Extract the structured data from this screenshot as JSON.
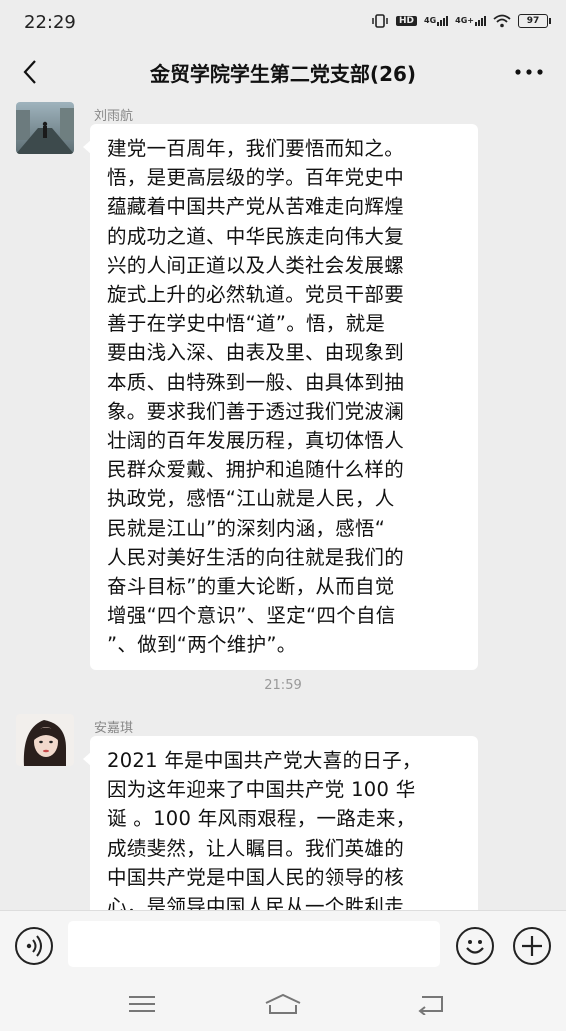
{
  "status_bar": {
    "time": "22:29",
    "hd_label": "HD",
    "net1": "4G",
    "net2": "4G+",
    "battery": "97"
  },
  "header": {
    "title": "金贸学院学生第二党支部(26)",
    "back_icon": "chevron-left-icon",
    "more_icon": "more-dots-icon"
  },
  "messages": [
    {
      "sender": "刘雨航",
      "lines": [
        "建党一百周年，我们要悟而知之。",
        "悟，是更高层级的学。百年党史中",
        "蕴藏着中国共产党从苦难走向辉煌",
        "的成功之道、中华民族走向伟大复",
        "兴的人间正道以及人类社会发展螺",
        "旋式上升的必然轨道。党员干部要",
        "善于在学史中悟“道”。悟，就是",
        "要由浅入深、由表及里、由现象到",
        "本质、由特殊到一般、由具体到抽",
        "象。要求我们善于透过我们党波澜",
        "壮阔的百年发展历程，真切体悟人",
        "民群众爱戴、拥护和追随什么样的",
        "执政党，感悟“江山就是人民，人",
        "民就是江山”的深刻内涵，感悟“",
        "人民对美好生活的向往就是我们的",
        "奋斗目标”的重大论断，从而自觉",
        "增强“四个意识”、坚定“四个自信",
        "”、做到“两个维护”。"
      ]
    },
    {
      "sender": "安嘉琪",
      "lines": [
        "2021 年是中国共产党大喜的日子，",
        "因为这年迎来了中国共产党 100 华",
        "诞 。100 年风雨艰程，一路走来，",
        "成绩斐然，让人瞩目。我们英雄的",
        "中国共产党是中国人民的领导的核",
        "心，是领导中国人民从一个胜利走"
      ]
    }
  ],
  "timestamp": "21:59",
  "input_bar": {
    "voice_icon": "voice-icon",
    "emoji_icon": "emoji-icon",
    "plus_icon": "plus-icon",
    "placeholder": ""
  },
  "nav_bar": {
    "menu_icon": "menu-icon",
    "home_icon": "home-icon",
    "back_icon": "back-icon"
  }
}
